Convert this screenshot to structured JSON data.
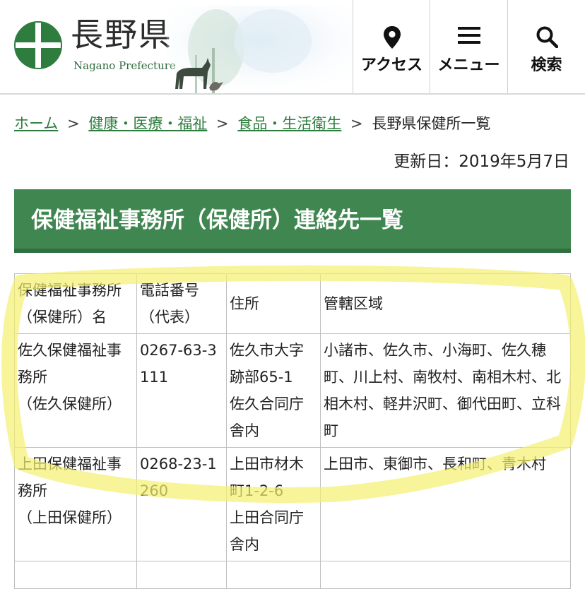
{
  "header": {
    "brand_ja": "長野県",
    "brand_en": "Nagano Prefecture",
    "nav": [
      {
        "label": "アクセス",
        "icon": "map-pin-icon"
      },
      {
        "label": "メニュー",
        "icon": "hamburger-menu-icon"
      },
      {
        "label": "検索",
        "icon": "search-icon"
      }
    ]
  },
  "breadcrumb": {
    "items": [
      "ホーム",
      "健康・医療・福祉",
      "食品・生活衛生"
    ],
    "separator": ">",
    "current": "長野県保健所一覧"
  },
  "updated": "更新日：2019年5月7日",
  "page_title": "保健福祉事務所（保健所）連絡先一覧",
  "table": {
    "headers": [
      {
        "line1": "保健福祉事務所",
        "line2": "（保健所）名"
      },
      {
        "line1": "電話番号",
        "line2": "（代表）"
      },
      {
        "line1": "住所"
      },
      {
        "line1": "管轄区域"
      }
    ],
    "rows": [
      {
        "name_line1": "佐久保健福祉事務所",
        "name_line2": "（佐久保健所）",
        "phone": "0267-63-3111",
        "address_line1": "佐久市大字跡部65-1",
        "address_line2": "佐久合同庁舎内",
        "area": "小諸市、佐久市、小海町、佐久穂町、川上村、南牧村、南相木村、北相木村、軽井沢町、御代田町、立科町"
      },
      {
        "name_line1": "上田保健福祉事務所",
        "name_line2": "（上田保健所）",
        "phone": "0268-23-1260",
        "address_line1": "上田市材木町1-2-6",
        "address_line2": "上田合同庁舎内",
        "area": "上田市、東御市、長和町、青木村"
      }
    ]
  },
  "colors": {
    "accent_green": "#3f8650",
    "link_green": "#2e7d3e",
    "highlighter": "#f3ef6e"
  }
}
